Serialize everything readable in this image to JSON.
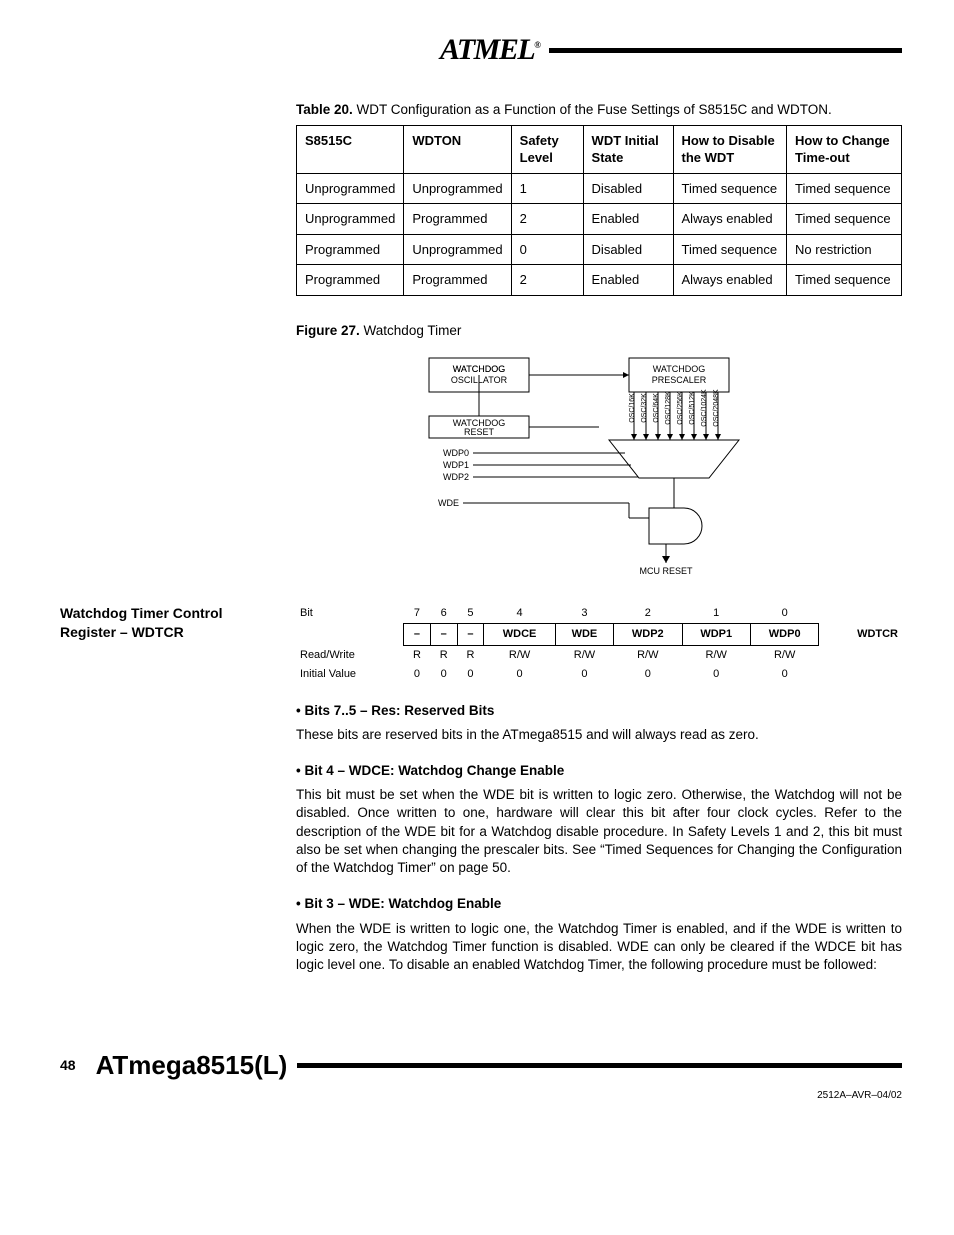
{
  "logo": {
    "text": "ATMEL",
    "reg": "®"
  },
  "table20": {
    "caption_strong": "Table 20.",
    "caption_rest": "WDT Configuration as a Function of the Fuse Settings of S8515C and WDTON.",
    "headers": [
      "S8515C",
      "WDTON",
      "Safety Level",
      "WDT Initial State",
      "How to Disable the WDT",
      "How to Change Time-out"
    ],
    "rows": [
      [
        "Unprogrammed",
        "Unprogrammed",
        "1",
        "Disabled",
        "Timed sequence",
        "Timed sequence"
      ],
      [
        "Unprogrammed",
        "Programmed",
        "2",
        "Enabled",
        "Always enabled",
        "Timed sequence"
      ],
      [
        "Programmed",
        "Unprogrammed",
        "0",
        "Disabled",
        "Timed sequence",
        "No restriction"
      ],
      [
        "Programmed",
        "Programmed",
        "2",
        "Enabled",
        "Always enabled",
        "Timed sequence"
      ]
    ]
  },
  "figure27": {
    "caption_strong": "Figure 27.",
    "caption_rest": "Watchdog Timer",
    "labels": {
      "osc": "WATCHDOG OSCILLATOR",
      "presc": "WATCHDOG PRESCALER",
      "reset": "WATCHDOG RESET",
      "taps": [
        "OSC/16K",
        "OSC/32K",
        "OSC/64K",
        "OSC/128K",
        "OSC/256K",
        "OSC/512K",
        "OSC/1024K",
        "OSC/2048K"
      ],
      "sel": [
        "WDP0",
        "WDP1",
        "WDP2"
      ],
      "wde": "WDE",
      "mcu": "MCU RESET"
    }
  },
  "sideheading": "Watchdog Timer Control Register – WDTCR",
  "register": {
    "bit_label": "Bit",
    "bits": [
      "7",
      "6",
      "5",
      "4",
      "3",
      "2",
      "1",
      "0"
    ],
    "names": [
      "–",
      "–",
      "–",
      "WDCE",
      "WDE",
      "WDP2",
      "WDP1",
      "WDP0"
    ],
    "regname": "WDTCR",
    "rw_label": "Read/Write",
    "rw": [
      "R",
      "R",
      "R",
      "R/W",
      "R/W",
      "R/W",
      "R/W",
      "R/W"
    ],
    "iv_label": "Initial Value",
    "iv": [
      "0",
      "0",
      "0",
      "0",
      "0",
      "0",
      "0",
      "0"
    ]
  },
  "sections": {
    "b75_head": "Bits 7..5 – Res: Reserved Bits",
    "b75_text": "These bits are reserved bits in the ATmega8515 and will always read as zero.",
    "b4_head": "Bit 4 – WDCE: Watchdog Change Enable",
    "b4_text": "This bit must be set when the WDE bit is written to logic zero. Otherwise, the Watchdog will not be disabled. Once written to one, hardware will clear this bit after four clock cycles. Refer to the description of the WDE bit for a Watchdog disable procedure. In Safety Levels 1 and 2, this bit must also be set when changing the prescaler bits. See “Timed Sequences for Changing the Configuration of the Watchdog Timer” on page 50.",
    "b3_head": "Bit 3 – WDE: Watchdog Enable",
    "b3_text": "When the WDE is written to logic one, the Watchdog Timer is enabled, and if the WDE is written to logic zero, the Watchdog Timer function is disabled. WDE can only be cleared if the WDCE bit has logic level one. To disable an enabled Watchdog Timer, the following procedure must be followed:"
  },
  "footer": {
    "page": "48",
    "title": "ATmega8515(L)",
    "rev": "2512A–AVR–04/02"
  }
}
